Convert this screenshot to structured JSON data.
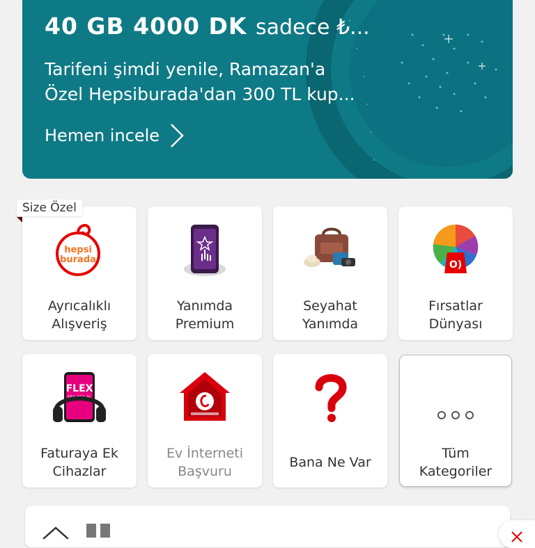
{
  "banner": {
    "headline": "40 GB 4000 DK",
    "headline_suffix": "sadece ₺...",
    "sub_line1": "Tarifeni şimdi yenile, Ramazan'a",
    "sub_line2": "Özel Hepsiburada'dan 300 TL kup...",
    "cta": "Hemen incele",
    "colors": {
      "background": "#0e7a86",
      "text": "#ffffff"
    }
  },
  "tag": {
    "label": "Size Özel"
  },
  "tiles": [
    {
      "label_line1": "Ayrıcalıklı",
      "label_line2": "Alışveriş",
      "icon": "hepsiburada-icon",
      "logo_text_1": "hepsi",
      "logo_text_2": "burada"
    },
    {
      "label_line1": "Yanımda",
      "label_line2": "Premium",
      "icon": "premium-phone-icon"
    },
    {
      "label_line1": "Seyahat",
      "label_line2": "Yanımda",
      "icon": "travel-icon"
    },
    {
      "label_line1": "Fırsatlar",
      "label_line2": "Dünyası",
      "icon": "color-wheel-icon"
    },
    {
      "label_line1": "Faturaya Ek",
      "label_line2": "Cihazlar",
      "icon": "flex-phone-icon",
      "logo_text_1": "FLEX",
      "logo_text_2": "SEÇ SEÇ AL"
    },
    {
      "label_line1": "Ev İnterneti",
      "label_line2": "Başvuru",
      "icon": "home-internet-icon"
    },
    {
      "label_line1": "Bana Ne Var",
      "icon": "question-mark-icon"
    },
    {
      "label_line1": "Tüm",
      "label_line2": "Kategoriler",
      "icon": "more-dots-icon"
    }
  ],
  "accent": "#e60000"
}
